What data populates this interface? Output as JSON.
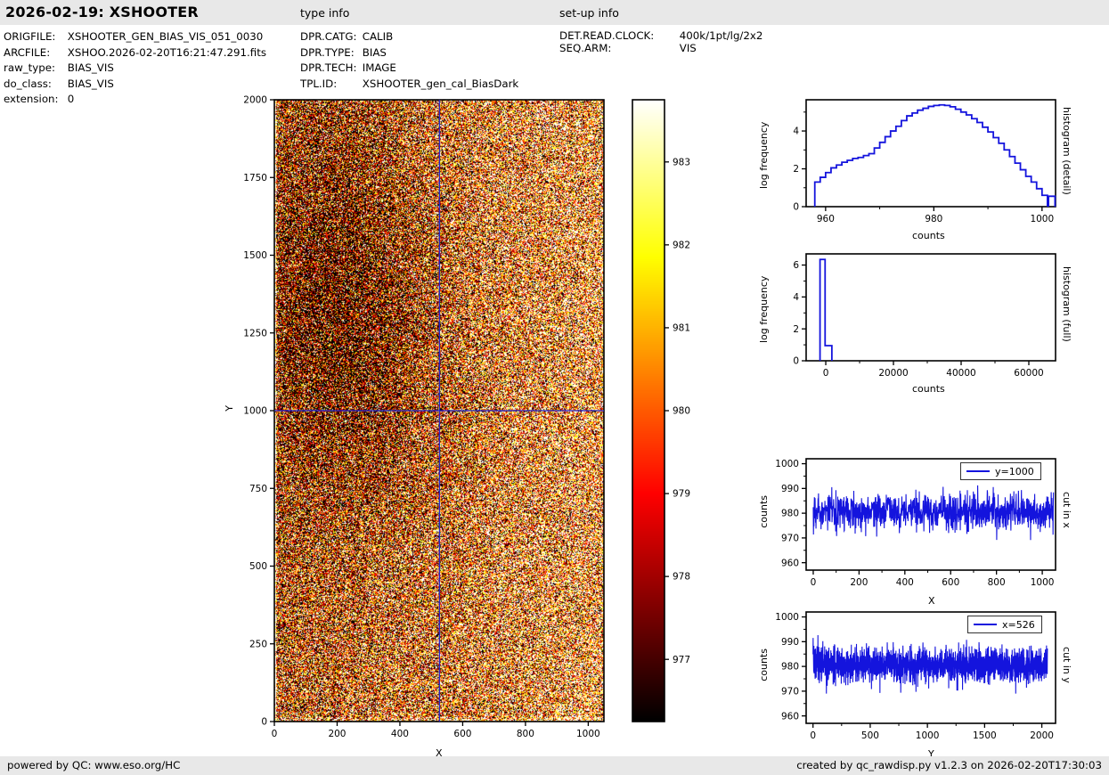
{
  "header": {
    "title": "2026-02-19: XSHOOTER"
  },
  "file_info": {
    "rows": [
      {
        "label": "ORIGFILE:",
        "value": "XSHOOTER_GEN_BIAS_VIS_051_0030"
      },
      {
        "label": "ARCFILE:",
        "value": "XSHOO.2026-02-20T16:21:47.291.fits"
      },
      {
        "label": "raw_type:",
        "value": "BIAS_VIS"
      },
      {
        "label": "do_class:",
        "value": "BIAS_VIS"
      },
      {
        "label": "extension:",
        "value": "0"
      }
    ]
  },
  "type_info": {
    "heading": "type info",
    "rows": [
      {
        "label": "DPR.CATG:",
        "value": "CALIB"
      },
      {
        "label": "DPR.TYPE:",
        "value": "BIAS"
      },
      {
        "label": "DPR.TECH:",
        "value": "IMAGE"
      },
      {
        "label": "TPL.ID:",
        "value": "XSHOOTER_gen_cal_BiasDark"
      }
    ]
  },
  "setup_info": {
    "heading": "set-up info",
    "rows": [
      {
        "label": "DET.READ.CLOCK:",
        "value": "400k/1pt/lg/2x2"
      },
      {
        "label": "SEQ.ARM:",
        "value": "VIS"
      }
    ]
  },
  "footer": {
    "left": "powered by QC: www.eso.org/HC",
    "right": "created by qc_rawdisp.py v1.2.3 on 2026-02-20T17:30:03"
  },
  "style": {
    "line_color": "#1414dd",
    "crosshair_color": "#2222cc",
    "bar_bg": "#e8e8e8"
  },
  "chart_data": [
    {
      "id": "main-image",
      "type": "heatmap",
      "xlabel": "X",
      "ylabel": "Y",
      "xlim": [
        0,
        1050
      ],
      "ylim": [
        0,
        2000
      ],
      "xticks": [
        0,
        200,
        400,
        600,
        800,
        1000
      ],
      "yticks": [
        0,
        250,
        500,
        750,
        1000,
        1250,
        1500,
        1750,
        2000
      ],
      "colormap": "hot",
      "vmin": 976.25,
      "vmax": 983.75,
      "crosshair": {
        "x": 526,
        "y": 1000
      },
      "noise": {
        "mean": 980.4,
        "sigma": 3.9,
        "seed": 42
      },
      "colorbar_ticks": [
        977,
        978,
        979,
        980,
        981,
        982,
        983
      ]
    },
    {
      "id": "hist-detail",
      "type": "step-histogram",
      "xlabel": "counts",
      "ylabel": "log frequency",
      "side_label": "histogram (detail)",
      "bin_start": 958,
      "bin_width": 1,
      "heights": [
        1.3,
        1.55,
        1.8,
        2.05,
        2.2,
        2.35,
        2.45,
        2.55,
        2.6,
        2.7,
        2.8,
        3.1,
        3.4,
        3.7,
        4.0,
        4.25,
        4.55,
        4.8,
        4.95,
        5.1,
        5.2,
        5.3,
        5.35,
        5.38,
        5.35,
        5.28,
        5.15,
        5.0,
        4.85,
        4.65,
        4.45,
        4.2,
        3.95,
        3.65,
        3.35,
        3.0,
        2.65,
        2.3,
        1.95,
        1.6,
        1.3,
        0.95,
        0.6
      ],
      "extra_bar": {
        "x0": 1001.2,
        "x1": 1002.4,
        "h": 0.55
      },
      "xlim": [
        956.4,
        1002.5
      ],
      "ylim": [
        0,
        5.65
      ],
      "xticks": [
        960,
        980,
        1000
      ],
      "xminor": [
        970,
        990
      ],
      "yticks": [
        0,
        2,
        4
      ],
      "yminor": [
        1,
        3,
        5
      ]
    },
    {
      "id": "hist-full",
      "type": "step-histogram-edges",
      "xlabel": "counts",
      "ylabel": "log frequency",
      "side_label": "histogram (full)",
      "edges": [
        -1700,
        -200,
        1800
      ],
      "heights": [
        6.35,
        0.95
      ],
      "xlim": [
        -5800,
        67900
      ],
      "ylim": [
        0,
        6.7
      ],
      "xticks": [
        0,
        20000,
        40000,
        60000
      ],
      "xminor": [
        10000,
        30000,
        50000
      ],
      "yticks": [
        0,
        2,
        4,
        6
      ],
      "yminor": [
        1,
        3,
        5
      ]
    },
    {
      "id": "cut-in-x",
      "type": "noise-line",
      "legend": "y=1000",
      "xlabel": "X",
      "ylabel": "counts",
      "side_label": "cut in x",
      "n": 1050,
      "mean": 980.4,
      "sigma": 3.6,
      "clip": [
        966.5,
        992.5
      ],
      "seed": 7,
      "xlim": [
        -31,
        1058
      ],
      "ylim": [
        957,
        1002
      ],
      "xticks": [
        0,
        200,
        400,
        600,
        800,
        1000
      ],
      "xminor": [
        100,
        300,
        500,
        700,
        900
      ],
      "yticks": [
        960,
        970,
        980,
        990,
        1000
      ],
      "yminor": [
        965,
        975,
        985,
        995
      ]
    },
    {
      "id": "cut-in-y",
      "type": "noise-line",
      "legend": "x=526",
      "xlabel": "Y",
      "ylabel": "counts",
      "side_label": "cut in y",
      "n": 2050,
      "mean": 980.7,
      "sigma": 3.5,
      "clip": [
        969.0,
        993.5
      ],
      "seed": 11,
      "xlim": [
        -60,
        2120
      ],
      "ylim": [
        957,
        1002
      ],
      "xticks": [
        0,
        500,
        1000,
        1500,
        2000
      ],
      "xminor": [
        250,
        750,
        1250,
        1750
      ],
      "yticks": [
        960,
        970,
        980,
        990,
        1000
      ],
      "yminor": [
        965,
        975,
        985,
        995
      ]
    }
  ]
}
